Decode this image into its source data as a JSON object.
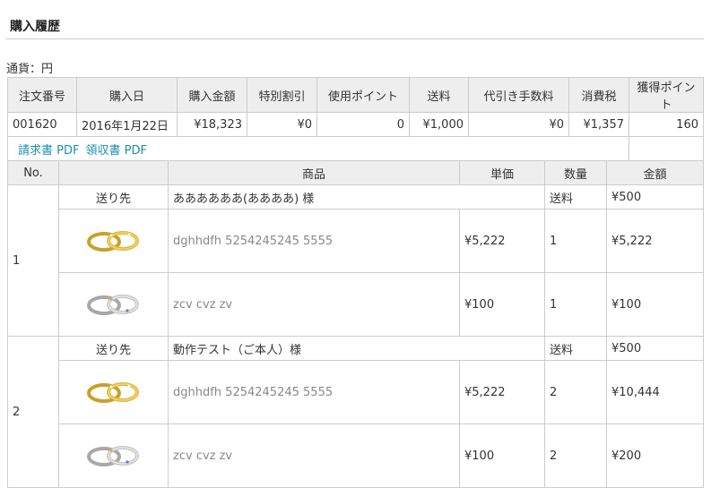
{
  "page": {
    "title": "購入履歴",
    "currency": "通貨：円"
  },
  "order": {
    "headers": [
      "注文番号",
      "購入日",
      "購入金額",
      "特別割引",
      "使用ポイント",
      "送料",
      "代引き手数料",
      "消費税",
      "獲得ポイント"
    ],
    "values": [
      "001620",
      "2016年1月22日",
      "¥18,323",
      "¥0",
      "0",
      "¥1,000",
      "¥0",
      "¥1,357",
      "160"
    ],
    "invoice_link": "請求書 PDF",
    "receipt_link": "領収書 PDF"
  },
  "items": {
    "headers": [
      "No.",
      "",
      "商品",
      "単価",
      "数量",
      "金額"
    ],
    "groups": [
      {
        "no": "1",
        "ship_label": "送り先",
        "recipient": "ああああああ(ああああ) 様",
        "fee_label": "送料",
        "fee": "¥500",
        "products": [
          {
            "image": "gold-rings",
            "name": "dghhdfh 5254245245 5555",
            "price": "¥5,222",
            "qty": "1",
            "amount": "¥5,222"
          },
          {
            "image": "silver-rings",
            "name": "zcv cvz zv",
            "price": "¥100",
            "qty": "1",
            "amount": "¥100"
          }
        ]
      },
      {
        "no": "2",
        "ship_label": "送り先",
        "recipient": "動作テスト（ご本人）様",
        "fee_label": "送料",
        "fee": "¥500",
        "products": [
          {
            "image": "gold-rings",
            "name": "dghhdfh 5254245245 5555",
            "price": "¥5,222",
            "qty": "2",
            "amount": "¥10,444"
          },
          {
            "image": "silver-rings",
            "name": "zcv cvz zv",
            "price": "¥100",
            "qty": "2",
            "amount": "¥200"
          }
        ]
      }
    ]
  },
  "colors": {
    "link": "#1a8fb0",
    "header_bg": "#eeeeee",
    "border": "#cccccc"
  }
}
